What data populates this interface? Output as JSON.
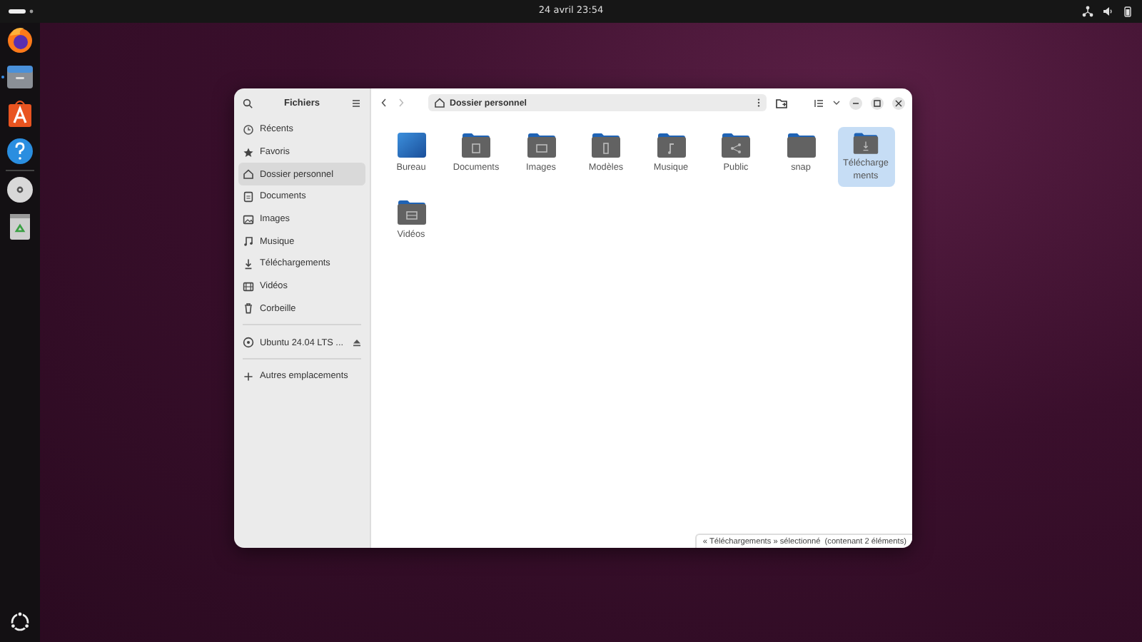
{
  "top_bar": {
    "clock": "24 avril 23:54"
  },
  "dock": {
    "apps": [
      {
        "kind": "browser",
        "running": false
      },
      {
        "kind": "files",
        "running": true
      },
      {
        "kind": "store",
        "running": false
      },
      {
        "kind": "help",
        "running": false
      },
      {
        "kind": "disc",
        "running": false
      },
      {
        "kind": "trash",
        "running": false
      }
    ]
  },
  "window": {
    "title": "Fichiers",
    "sidebar": {
      "places": [
        {
          "label": "Récents",
          "kind": "clock",
          "selected": false
        },
        {
          "label": "Favoris",
          "kind": "star",
          "selected": false
        },
        {
          "label": "Dossier personnel",
          "kind": "home",
          "selected": true
        },
        {
          "label": "Documents",
          "kind": "document",
          "selected": false
        },
        {
          "label": "Images",
          "kind": "image",
          "selected": false
        },
        {
          "label": "Musique",
          "kind": "music",
          "selected": false
        },
        {
          "label": "Téléchargements",
          "kind": "download",
          "selected": false
        },
        {
          "label": "Vidéos",
          "kind": "film",
          "selected": false
        },
        {
          "label": "Corbeille",
          "kind": "trash",
          "selected": false
        }
      ],
      "drives": [
        {
          "label": "Ubuntu 24.04 LTS ...",
          "kind": "disc",
          "selected": false
        }
      ],
      "other": [
        {
          "label": "Autres emplacements",
          "kind": "plus",
          "selected": false
        }
      ]
    },
    "path": "Dossier personnel",
    "folders": [
      {
        "label": "Bureau",
        "kind": "desktop",
        "selected": false
      },
      {
        "label": "Documents",
        "kind": "document",
        "selected": false
      },
      {
        "label": "Images",
        "kind": "image",
        "selected": false
      },
      {
        "label": "Modèles",
        "kind": "template",
        "selected": false
      },
      {
        "label": "Musique",
        "kind": "music",
        "selected": false
      },
      {
        "label": "Public",
        "kind": "share",
        "selected": false
      },
      {
        "label": "snap",
        "kind": "plain",
        "selected": false
      },
      {
        "label": "Téléchargements",
        "kind": "download",
        "selected": true
      },
      {
        "label": "Vidéos",
        "kind": "film",
        "selected": false
      }
    ],
    "status": "« Téléchargements » sélectionné  (contenant 2 éléments)"
  }
}
